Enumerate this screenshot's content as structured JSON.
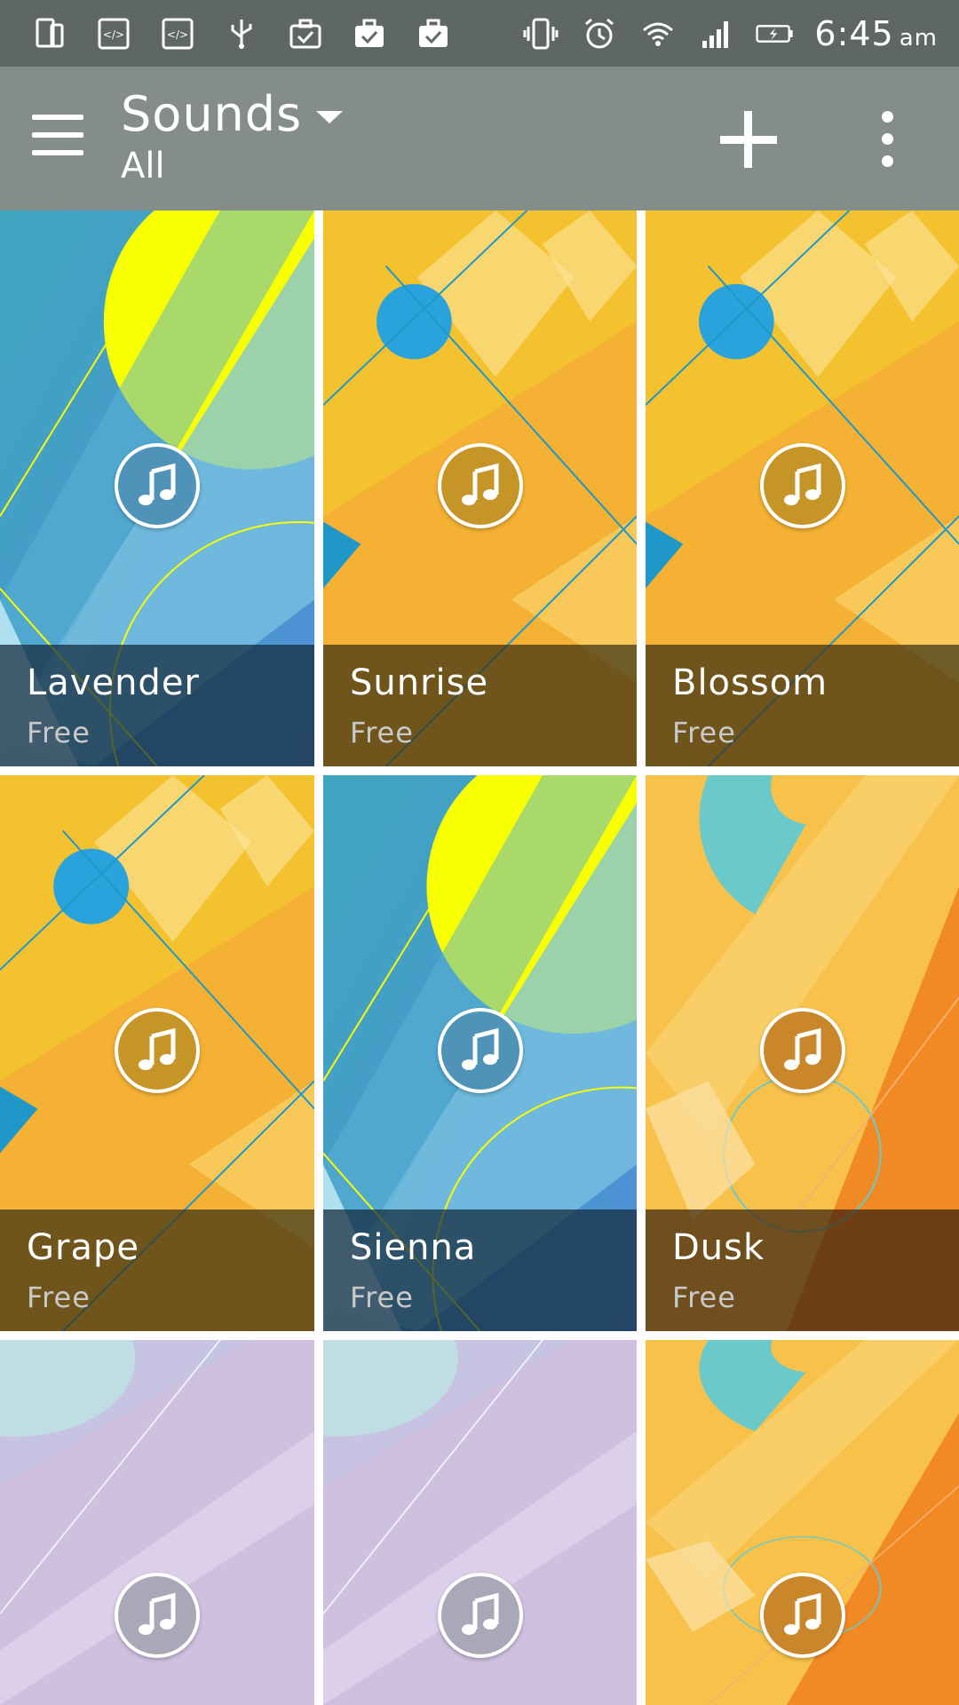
{
  "status_bar": {
    "time": "6:45",
    "ampm": "am",
    "icons": [
      "tablet-icon",
      "code-icon",
      "code-icon",
      "usb-icon",
      "briefcase-check-icon",
      "briefcase-check-icon",
      "briefcase-check-icon",
      "vibrate-icon",
      "alarm-icon",
      "wifi-icon",
      "signal-icon",
      "battery-charging-icon"
    ]
  },
  "app_bar": {
    "title": "Sounds",
    "subtitle": "All",
    "menu_icon": "hamburger-menu-icon",
    "add_icon": "plus-icon",
    "overflow_icon": "more-vert-icon"
  },
  "themes": [
    {
      "name": "Lavender",
      "price": "Free",
      "style": "blue"
    },
    {
      "name": "Sunrise",
      "price": "Free",
      "style": "yellow"
    },
    {
      "name": "Blossom",
      "price": "Free",
      "style": "yellow"
    },
    {
      "name": "Grape",
      "price": "Free",
      "style": "yellow"
    },
    {
      "name": "Sienna",
      "price": "Free",
      "style": "blue"
    },
    {
      "name": "Dusk",
      "price": "Free",
      "style": "orange"
    },
    {
      "name": "",
      "price": "",
      "style": "purple"
    },
    {
      "name": "",
      "price": "",
      "style": "purple"
    },
    {
      "name": "",
      "price": "",
      "style": "orange"
    }
  ],
  "colors": {
    "status_bar": "#5f6766",
    "app_bar": "#858d8b",
    "blue_button": "#4f94b8",
    "yellow_button": "#c59527",
    "orange_button": "#c9862a",
    "purple_button": "#a9a7b8"
  }
}
